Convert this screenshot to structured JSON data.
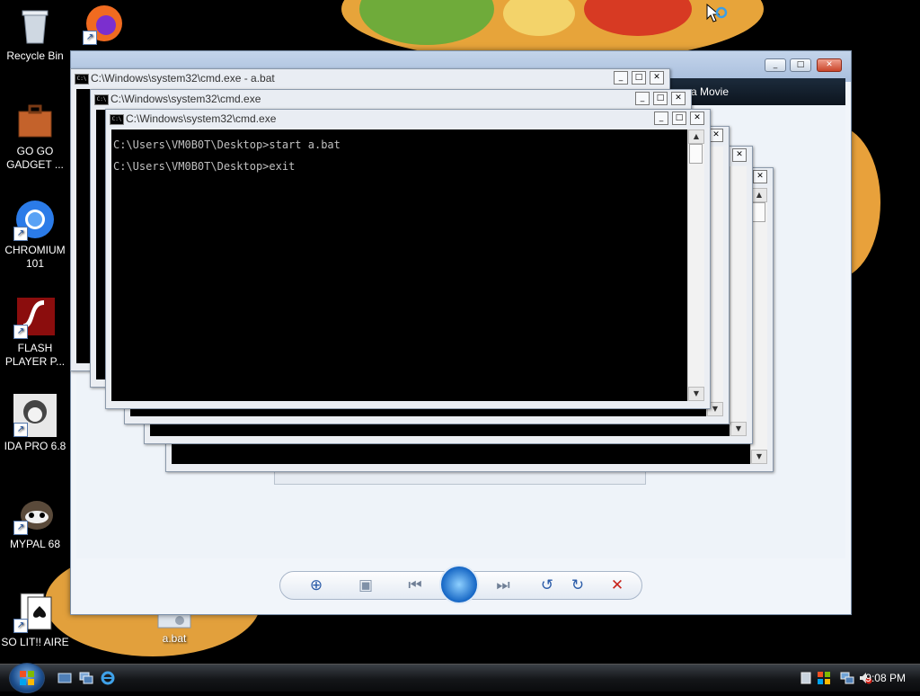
{
  "desktop": {
    "icons": [
      {
        "label": "Recycle Bin",
        "icon": "recycle-bin-icon"
      },
      {
        "label": "GO GO GADGET ...",
        "icon": "briefcase-icon"
      },
      {
        "label": "CHROMIUM 101",
        "icon": "chromium-icon"
      },
      {
        "label": "FLASH PLAYER P...",
        "icon": "flash-icon"
      },
      {
        "label": "IDA PRO 6.8",
        "icon": "ida-icon"
      },
      {
        "label": "MYPAL 68",
        "icon": "raccoon-icon"
      },
      {
        "label": "SO LIT!! AIRE",
        "icon": "cards-icon"
      },
      {
        "label": "a.bat",
        "icon": "batch-file-icon"
      }
    ]
  },
  "photo_viewer": {
    "menu_fragment": "a Movie",
    "controls": {
      "zoom": "⊕",
      "fit": "▣",
      "prev": "⏮",
      "next": "⏭",
      "rotate_ccw": "↺",
      "rotate_cw": "↻",
      "delete": "✕"
    }
  },
  "cmd_windows": [
    {
      "title": "C:\\Windows\\system32\\cmd.exe - a.bat"
    },
    {
      "title": "C:\\Windows\\system32\\cmd.exe"
    },
    {
      "title": "C:\\Windows\\system32\\cmd.exe",
      "lines": [
        "C:\\Users\\VM0B0T\\Desktop>start a.bat",
        "C:\\Users\\VM0B0T\\Desktop>exit"
      ]
    }
  ],
  "window_buttons": {
    "minimize": "_",
    "maximize": "□",
    "close": "✕"
  },
  "taskbar": {
    "clock": "9:08 PM"
  },
  "colors": {
    "taskbar": "#141619",
    "console_bg": "#000000",
    "console_text": "#c0c0c0",
    "accent": "#1465c4"
  }
}
